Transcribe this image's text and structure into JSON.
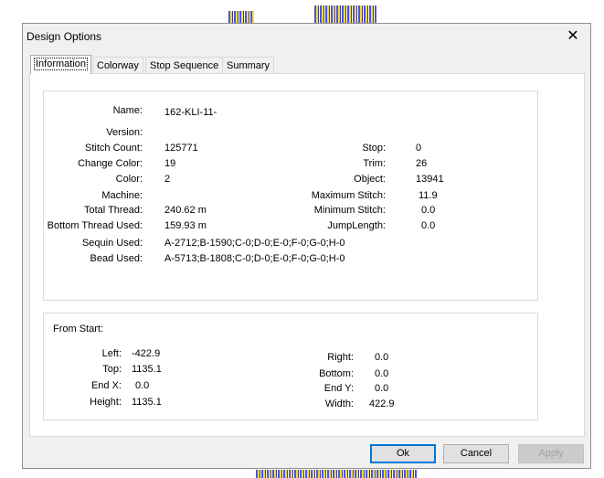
{
  "dialog": {
    "title": "Design Options",
    "close_glyph": "✕",
    "tabs": [
      {
        "label": "Information",
        "active": true
      },
      {
        "label": "Colorway",
        "active": false
      },
      {
        "label": "Stop Sequence",
        "active": false
      },
      {
        "label": "Summary",
        "active": false
      }
    ]
  },
  "info": {
    "name_label": "Name:",
    "name_value": "162-KLI-11-",
    "version_label": "Version:",
    "version_value": "",
    "stitch_count_label": "Stitch Count:",
    "stitch_count_value": "125771",
    "change_color_label": "Change Color:",
    "change_color_value": "19",
    "color_label": "Color:",
    "color_value": "2",
    "machine_label": "Machine:",
    "machine_value": "",
    "total_thread_label": "Total Thread:",
    "total_thread_value": "240.62 m",
    "bottom_thread_label": "Bottom Thread Used:",
    "bottom_thread_value": "159.93 m",
    "sequin_label": "Sequin Used:",
    "sequin_value": "A-2712;B-1590;C-0;D-0;E-0;F-0;G-0;H-0",
    "bead_label": "Bead Used:",
    "bead_value": "A-5713;B-1808;C-0;D-0;E-0;F-0;G-0;H-0",
    "stop_label": "Stop:",
    "stop_value": "0",
    "trim_label": "Trim:",
    "trim_value": "26",
    "object_label": "Object:",
    "object_value": "13941",
    "max_stitch_label": "Maximum Stitch:",
    "max_stitch_value": "11.9",
    "min_stitch_label": "Minimum Stitch:",
    "min_stitch_value": "0.0",
    "jump_length_label": "JumpLength:",
    "jump_length_value": "0.0"
  },
  "from_start": {
    "heading": "From Start:",
    "left_label": "Left:",
    "left_value": "-422.9",
    "top_label": "Top:",
    "top_value": "1135.1",
    "endx_label": "End X:",
    "endx_value": "0.0",
    "height_label": "Height:",
    "height_value": "1135.1",
    "right_label": "Right:",
    "right_value": "0.0",
    "bottom_label": "Bottom:",
    "bottom_value": "0.0",
    "endy_label": "End Y:",
    "endy_value": "0.0",
    "width_label": "Width:",
    "width_value": "422.9"
  },
  "buttons": {
    "ok": "Ok",
    "cancel": "Cancel",
    "apply": "Apply"
  }
}
